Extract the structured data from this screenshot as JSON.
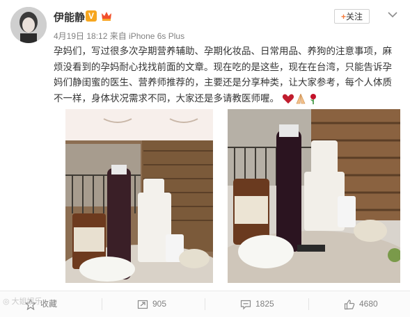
{
  "user": {
    "name": "伊能静",
    "verified_badge": "V"
  },
  "meta": {
    "text": "4月19日 18:12 来自 iPhone 6s Plus"
  },
  "follow": {
    "plus": "+",
    "label": "关注"
  },
  "post": {
    "text": "孕妈们，写过很多次孕期营养辅助、孕期化妆品、日常用品、养狗的注意事项，麻烦没看到的孕妈耐心找找前面的文章。现在吃的是这些，现在在台湾，只能告诉孕妈们静闺蜜的医生、营养师推荐的，主要还是分享种类，让大家参考，每个人体质不一样，身体状况需求不同，大家还是多请教医师喔。",
    "emojis": [
      "heart-icon",
      "pray-icon",
      "rose-icon"
    ]
  },
  "actions": {
    "collect": "收藏",
    "repost": "905",
    "comment": "1825",
    "like": "4680"
  },
  "watermark": "大姐娱乐",
  "colors": {
    "follow_plus": "#f77c3d",
    "badge": "#f6a61f",
    "meta": "#808080"
  }
}
